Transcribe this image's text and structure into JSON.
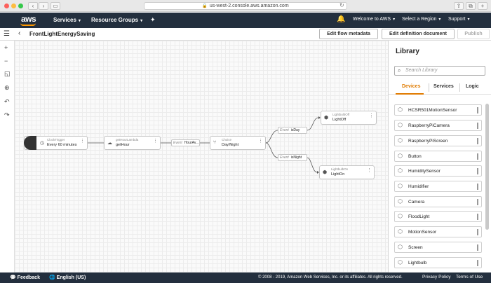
{
  "browser": {
    "url": "us-west-2.console.aws.amazon.com",
    "dots": [
      "#fc605c",
      "#fdbc40",
      "#34c84a"
    ]
  },
  "aws_bar": {
    "logo": "aws",
    "services": "Services",
    "resource_groups": "Resource Groups",
    "welcome": "Welcome to AWS",
    "region": "Select a Region",
    "support": "Support"
  },
  "app_header": {
    "flow_name": "FrontLightEnergySaving",
    "edit_flow_metadata": "Edit flow metadata",
    "edit_definition_document": "Edit definition document",
    "publish": "Publish"
  },
  "canvas": {
    "nodes": {
      "clock": {
        "sub": "ClockTrigger",
        "label": "Every 60 minutes"
      },
      "lambda": {
        "sub": "getHourLambda",
        "label": "getHour"
      },
      "choice": {
        "sub": "Choice",
        "label": "Day/Night"
      },
      "off": {
        "sub": "LightbulbOff",
        "label": "LightOff"
      },
      "on": {
        "sub": "LightbulbOn",
        "label": "LightOn"
      }
    },
    "events": {
      "hour": {
        "key": "Event",
        "value": "HourAv..."
      },
      "day": {
        "key": "Event",
        "value": "isDay"
      },
      "night": {
        "key": "Event",
        "value": "isNight"
      }
    }
  },
  "library": {
    "title": "Library",
    "search_placeholder": "Search Library",
    "tabs": [
      "Devices",
      "Services",
      "Logic"
    ],
    "active_tab": "Devices",
    "items": [
      "HCSR501MotionSensor",
      "RaspberryPiCamera",
      "RaspberryPiScreen",
      "Button",
      "HumiditySensor",
      "Humidifier",
      "Camera",
      "FloodLight",
      "MotionSensor",
      "Screen",
      "Lightbulb"
    ]
  },
  "footer": {
    "feedback": "Feedback",
    "language": "English (US)",
    "copyright": "© 2008 - 2019, Amazon Web Services, Inc. or its affiliates. All rights reserved.",
    "privacy": "Privacy Policy",
    "terms": "Terms of Use"
  },
  "colors": {
    "aws_bar": "#232f3e",
    "accent": "#e07b00",
    "aws_orange": "#ff9900"
  }
}
